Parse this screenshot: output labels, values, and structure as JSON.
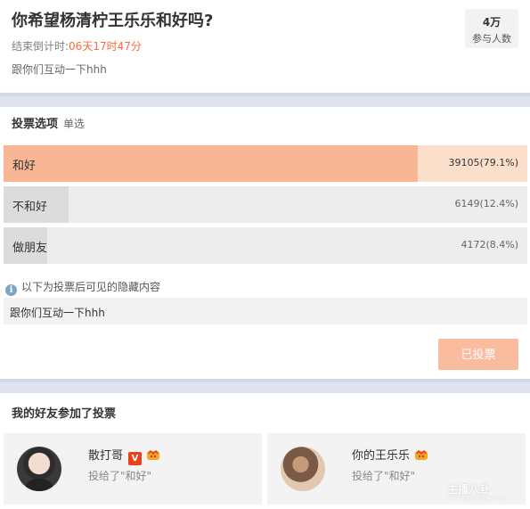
{
  "poll": {
    "title": "你希望杨清柠王乐乐和好吗?",
    "countdown_label": "结束倒计时:",
    "countdown_time": "06天17时47分",
    "description": "跟你们互动一下hhh",
    "participants_count": "4万",
    "participants_label": "参与人数"
  },
  "options_section": {
    "title": "投票选项",
    "mode": "单选"
  },
  "options": [
    {
      "label": "和好",
      "result": "39105(79.1%)",
      "percent": 79.1,
      "selected": true
    },
    {
      "label": "不和好",
      "result": "6149(12.4%)",
      "percent": 12.4,
      "selected": false
    },
    {
      "label": "做朋友",
      "result": "4172(8.4%)",
      "percent": 8.4,
      "selected": false
    }
  ],
  "hidden": {
    "tip": "以下为投票后可见的隐藏内容",
    "content": "跟你们互动一下hhh"
  },
  "vote_button": {
    "label": "已投票"
  },
  "friends": {
    "title": "我的好友参加了投票",
    "items": [
      {
        "name": "散打哥",
        "action": "投给了\"和好\"",
        "verified": "V"
      },
      {
        "name": "你的王乐乐",
        "action": "投给了\"和好\""
      }
    ]
  },
  "watermark": {
    "text": "主播八卦",
    "sub": "www.zhubo8gua.com"
  },
  "colors": {
    "selected_fill": "#f8b694",
    "selected_track": "#fde0cc",
    "countdown": "#ff6a3d",
    "button": "#f9bc9f"
  }
}
